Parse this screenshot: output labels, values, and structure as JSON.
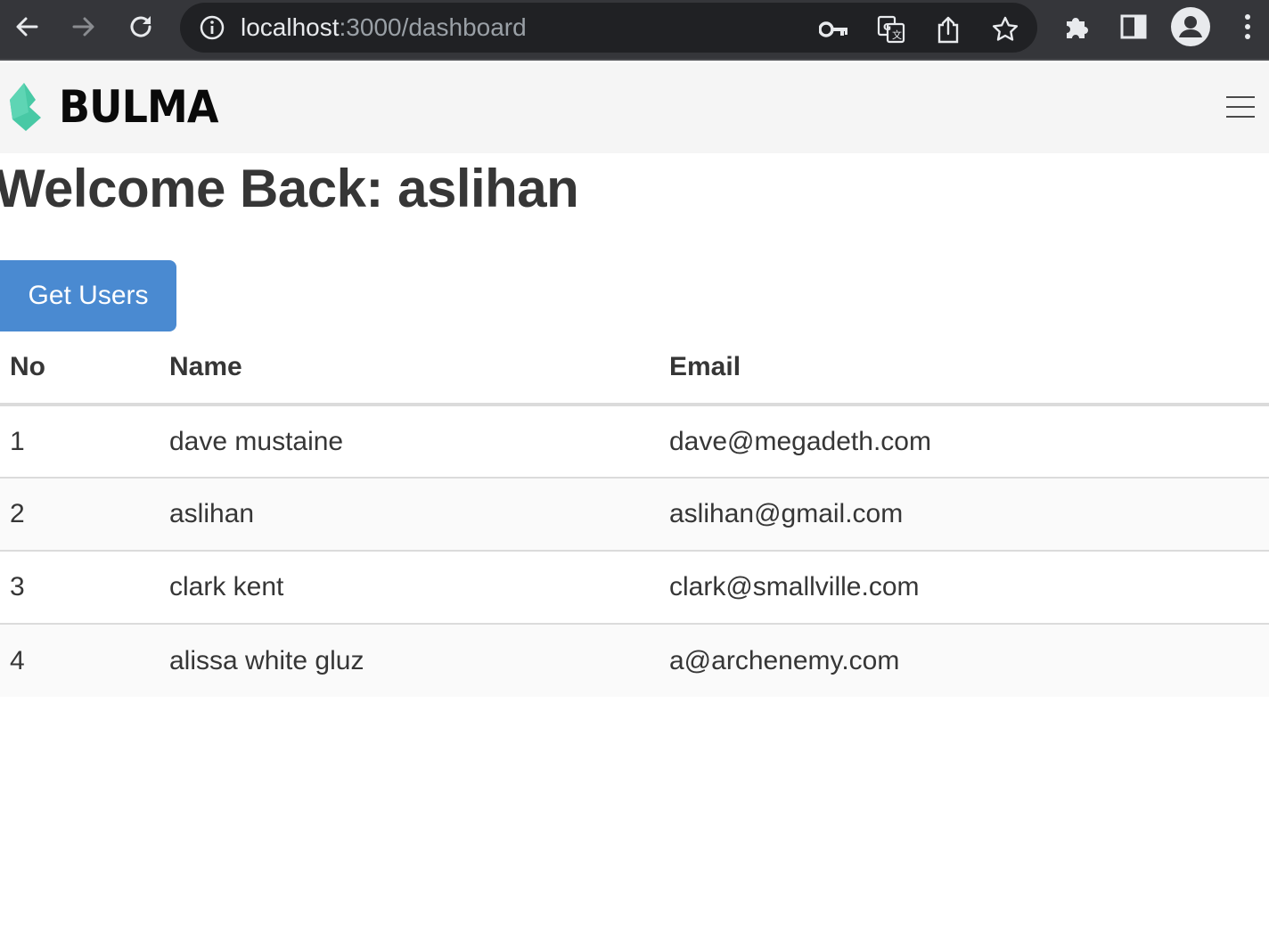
{
  "browser": {
    "url_host": "localhost",
    "url_path": ":3000/dashboard"
  },
  "navbar": {
    "brand": "BULMA",
    "brand_color": "#00d1b2"
  },
  "page": {
    "title": "Welcome Back: aslihan",
    "get_users_label": "Get Users",
    "button_color": "#4a8ad1"
  },
  "table": {
    "headers": [
      "No",
      "Name",
      "Email"
    ],
    "rows": [
      [
        "1",
        "dave mustaine",
        "dave@megadeth.com"
      ],
      [
        "2",
        "aslihan",
        "aslihan@gmail.com"
      ],
      [
        "3",
        "clark kent",
        "clark@smallville.com"
      ],
      [
        "4",
        "alissa white gluz",
        "a@archenemy.com"
      ]
    ]
  }
}
